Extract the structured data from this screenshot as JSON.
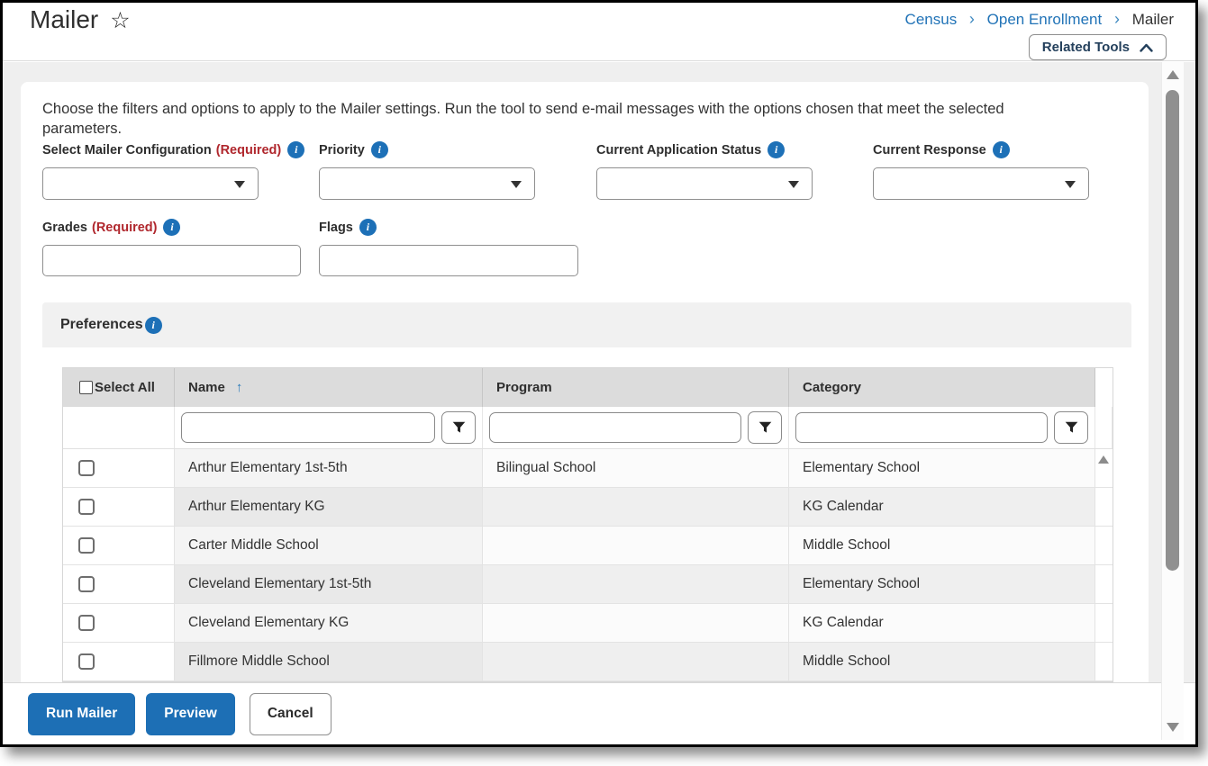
{
  "header": {
    "title": "Mailer",
    "star_icon": "☆",
    "breadcrumb": {
      "items": [
        "Census",
        "Open Enrollment",
        "Mailer"
      ],
      "separator": "›"
    },
    "related_tools_label": "Related Tools"
  },
  "intro": {
    "text": "Choose the filters and options to apply to the Mailer settings. Run the tool to send e-mail messages with the options chosen that meet the selected parameters."
  },
  "form": {
    "select_mailer_configuration": {
      "label": "Select Mailer Configuration",
      "required": "(Required)",
      "value": ""
    },
    "priority": {
      "label": "Priority",
      "value": ""
    },
    "current_application_status": {
      "label": "Current Application Status",
      "value": ""
    },
    "current_response": {
      "label": "Current Response",
      "value": ""
    },
    "grades": {
      "label": "Grades",
      "required": "(Required)",
      "value": ""
    },
    "flags": {
      "label": "Flags",
      "value": ""
    },
    "info_icon_glyph": "i"
  },
  "preferences": {
    "title": "Preferences",
    "table": {
      "select_all_label": "Select All",
      "columns": [
        "Name",
        "Program",
        "Category"
      ],
      "sort": {
        "column": "Name",
        "direction": "ascending",
        "arrow": "↑"
      },
      "filters": {
        "name": "",
        "program": "",
        "category": ""
      },
      "rows": [
        {
          "name": "Arthur Elementary 1st-5th",
          "program": "Bilingual School",
          "category": "Elementary School",
          "selected": false
        },
        {
          "name": "Arthur Elementary KG",
          "program": "",
          "category": "KG Calendar",
          "selected": false
        },
        {
          "name": "Carter Middle School",
          "program": "",
          "category": "Middle School",
          "selected": false
        },
        {
          "name": "Cleveland Elementary 1st-5th",
          "program": "",
          "category": "Elementary School",
          "selected": false
        },
        {
          "name": "Cleveland Elementary KG",
          "program": "",
          "category": "KG Calendar",
          "selected": false
        },
        {
          "name": "Fillmore Middle School",
          "program": "",
          "category": "Middle School",
          "selected": false
        }
      ]
    }
  },
  "actions": {
    "run_mailer": "Run Mailer",
    "preview": "Preview",
    "cancel": "Cancel"
  },
  "colors": {
    "accent_blue": "#1d6fb5",
    "link_blue": "#2173b7",
    "required_red": "#b0272d",
    "info_blue": "#1d70b7"
  }
}
